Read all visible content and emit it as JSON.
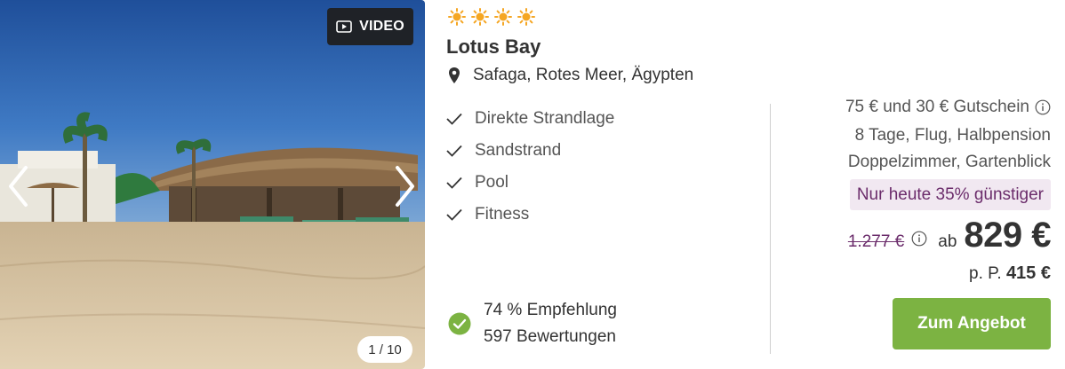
{
  "gallery": {
    "video_label": "VIDEO",
    "counter": "1 / 10"
  },
  "hotel": {
    "stars": 4,
    "name": "Lotus Bay",
    "location": "Safaga, Rotes Meer, Ägypten",
    "features": [
      "Direkte Strandlage",
      "Sandstrand",
      "Pool",
      "Fitness"
    ],
    "recommendation": "74 % Empfehlung",
    "reviews": "597 Bewertungen"
  },
  "offer": {
    "voucher": "75 € und 30 € Gutschein",
    "trip": "8 Tage, Flug, Halbpension",
    "room": "Doppelzimmer, Gartenblick",
    "deal": "Nur heute 35% günstiger",
    "old_price": "1.277 €",
    "from_label": "ab",
    "price": "829 €",
    "per_person_label": "p. P.",
    "per_person_price": "415 €",
    "cta": "Zum Angebot"
  },
  "colors": {
    "star": "#f5a623",
    "accent_purple": "#6b2c6b",
    "deal_bg": "#f1e8f1",
    "cta": "#7cb342",
    "check_green": "#7cb342"
  },
  "icons": [
    "sun-star-icon",
    "map-pin-icon",
    "checkmark-icon",
    "check-circle-icon",
    "info-icon",
    "play-icon",
    "chevron-left-icon",
    "chevron-right-icon"
  ]
}
